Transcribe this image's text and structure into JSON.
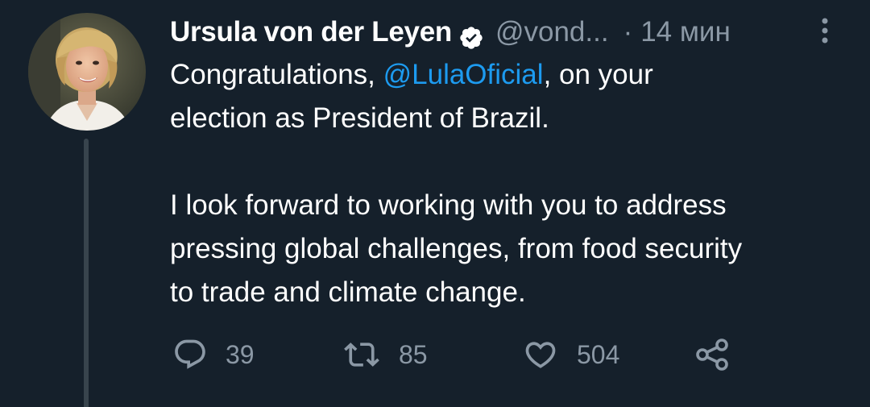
{
  "tweet": {
    "author_name": "Ursula von der Leyen",
    "author_handle": "@vond...",
    "separator": "·",
    "time": "14 мин",
    "text": {
      "line1_before": "Congratulations, ",
      "line1_mention": "@LulaOficial",
      "line1_after": ", on your",
      "line2": "election as President of Brazil.",
      "line3": "I look forward to working with you to address",
      "line4": "pressing global challenges, from food security",
      "line5": "to trade and climate change."
    },
    "replies": "39",
    "retweets": "85",
    "likes": "504"
  },
  "colors": {
    "background": "#15202b",
    "text": "#ffffff",
    "secondary": "#8b98a5",
    "link": "#1d9bf0",
    "thread_line": "#38444d"
  },
  "icons": {
    "verified": "verified-badge-icon",
    "more": "more-vertical-icon",
    "reply": "reply-icon",
    "retweet": "retweet-icon",
    "like": "heart-icon",
    "share": "share-icon"
  }
}
